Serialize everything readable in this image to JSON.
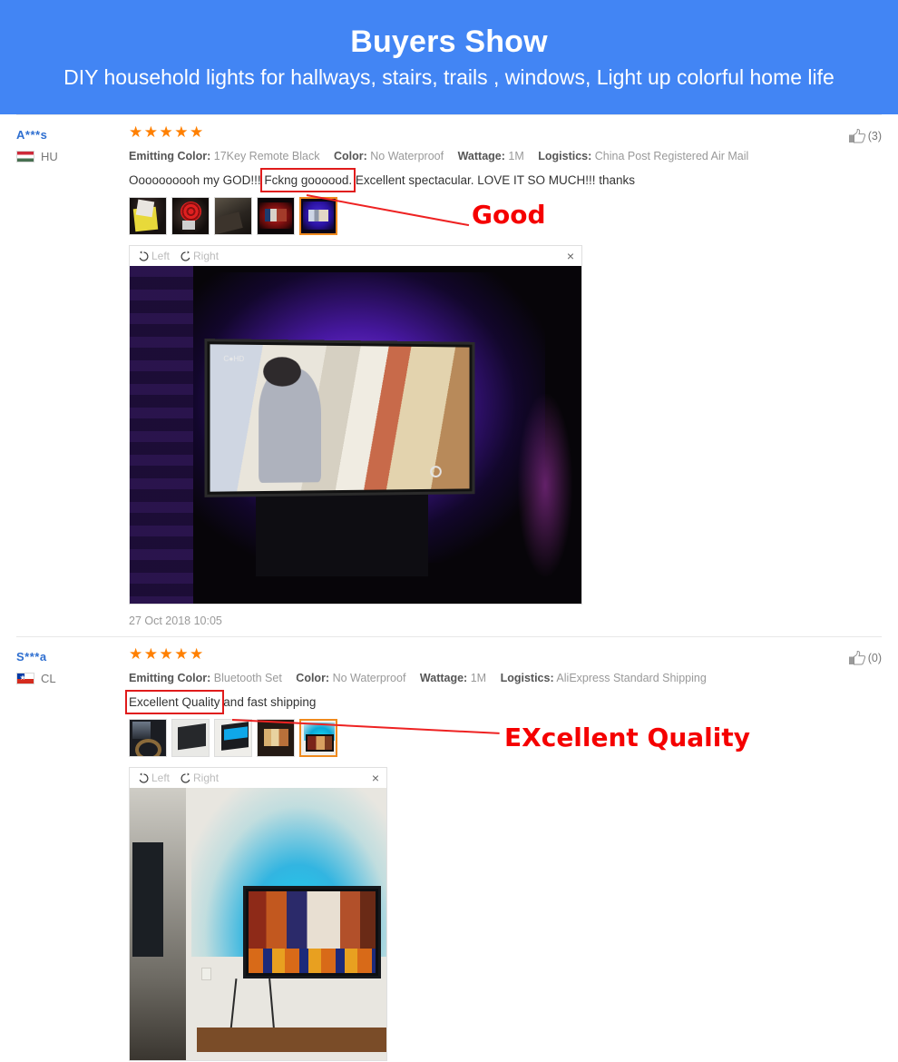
{
  "banner": {
    "title": "Buyers Show",
    "subtitle": "DIY household lights for hallways, stairs, trails , windows, Light up colorful home life",
    "bg_color": "#4285f4"
  },
  "viewer_controls": {
    "rotate_left_label": "Left",
    "rotate_right_label": "Right",
    "close_label": "×"
  },
  "annotations": [
    {
      "text": "Good",
      "color": "#f50000"
    },
    {
      "text": "EXcellent Quality",
      "color": "#f50000"
    }
  ],
  "reviews": [
    {
      "user": "A***s",
      "country_code": "HU",
      "country_flag": "hungary-flag-icon",
      "stars": "★★★★★",
      "star_count": 5,
      "likes": "(3)",
      "attributes": [
        {
          "key": "Emitting Color:",
          "value": "17Key Remote Black"
        },
        {
          "key": "Color:",
          "value": "No Waterproof"
        },
        {
          "key": "Wattage:",
          "value": "1M"
        },
        {
          "key": "Logistics:",
          "value": "China Post Registered Air Mail"
        }
      ],
      "comment_before": "Oooooooooh my GOD!!! ",
      "comment_highlight": "Fckng goooood.",
      "comment_after": " Excellent spectacular. LOVE IT SO MUCH!!! thanks",
      "thumbnails": [
        "photo-package-yellow",
        "photo-red-led-coil",
        "photo-dark-fabric",
        "photo-tv-red-glow",
        "photo-tv-blue-glow"
      ],
      "selected_thumbnail_index": 4,
      "date": "27 Oct 2018 10:05"
    },
    {
      "user": "S***a",
      "country_code": "CL",
      "country_flag": "chile-flag-icon",
      "stars": "★★★★★",
      "star_count": 5,
      "likes": "(0)",
      "attributes": [
        {
          "key": "Emitting Color:",
          "value": "Bluetooth Set"
        },
        {
          "key": "Color:",
          "value": "No Waterproof"
        },
        {
          "key": "Wattage:",
          "value": "1M"
        },
        {
          "key": "Logistics:",
          "value": "AliExpress Standard Shipping"
        }
      ],
      "comment_before": "",
      "comment_highlight": "Excellent Quality",
      "comment_after": " and fast shipping",
      "thumbnails": [
        "photo-desk-equipment",
        "photo-tv-back-panel",
        "photo-tv-blue-edge",
        "photo-room-tv",
        "photo-tv-cyan-glow"
      ],
      "selected_thumbnail_index": 4,
      "date": ""
    }
  ]
}
